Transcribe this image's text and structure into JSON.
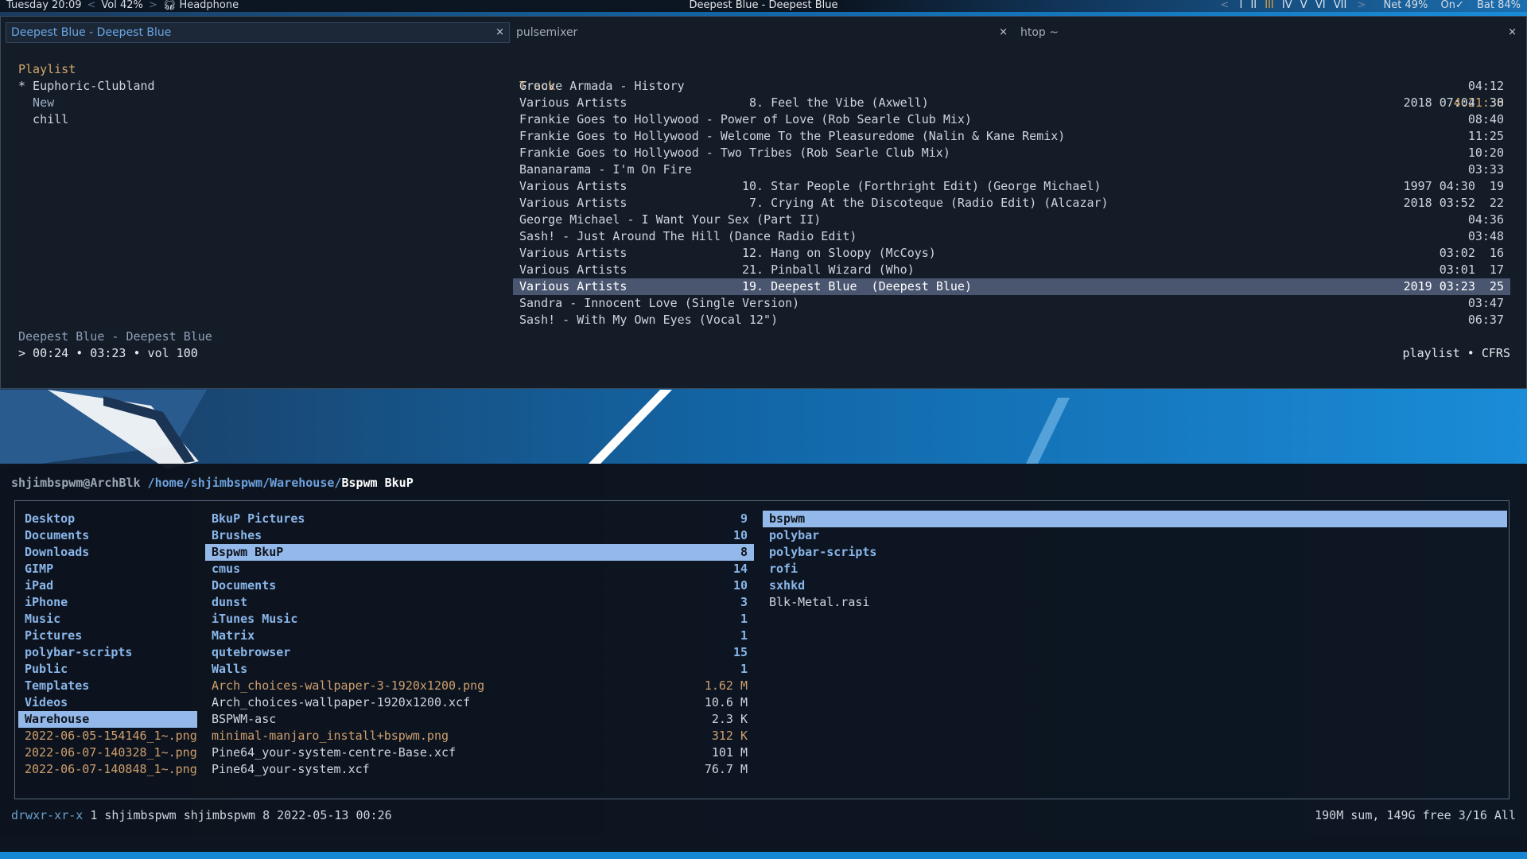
{
  "topbar": {
    "day_time": "Tuesday 20:09",
    "volume": "Vol 42%",
    "audio_device": "Headphone",
    "window_title": "Deepest Blue - Deepest Blue",
    "workspaces": [
      "I",
      "II",
      "III",
      "IV",
      "V",
      "VI",
      "VII"
    ],
    "active_workspace": "III",
    "net": "Net 49%",
    "on_status": "On✓",
    "battery": "Bat 84%"
  },
  "tabs": [
    {
      "label": "Deepest Blue - Deepest Blue",
      "close": "×"
    },
    {
      "label": "pulsemixer",
      "close": "×"
    },
    {
      "label": "htop ~",
      "close": "×"
    }
  ],
  "playlist": {
    "header": "Playlist",
    "items": [
      "* Euphoric-Clubland",
      "  New",
      "  chill"
    ]
  },
  "tracks": {
    "header": "Track",
    "total_duration": "4:21:38",
    "rows": [
      {
        "artist": "Groove Armada - History",
        "title": "",
        "right": "04:12"
      },
      {
        "artist": "Various Artists",
        "title": " 8. Feel the Vibe (Axwell)",
        "right": "2018 07:04  30"
      },
      {
        "artist": "Frankie Goes to Hollywood - Power of Love (Rob Searle Club Mix)",
        "title": "",
        "right": "08:40"
      },
      {
        "artist": "Frankie Goes to Hollywood - Welcome To the Pleasuredome (Nalin & Kane Remix)",
        "title": "",
        "right": "11:25"
      },
      {
        "artist": "Frankie Goes to Hollywood - Two Tribes (Rob Searle Club Mix)",
        "title": "",
        "right": "10:20"
      },
      {
        "artist": "Bananarama - I'm On Fire",
        "title": "",
        "right": "03:33"
      },
      {
        "artist": "Various Artists",
        "title": "10. Star People (Forthright Edit) (George Michael)",
        "right": "1997 04:30  19"
      },
      {
        "artist": "Various Artists",
        "title": " 7. Crying At the Discoteque (Radio Edit) (Alcazar)",
        "right": "2018 03:52  22"
      },
      {
        "artist": "George Michael - I Want Your Sex (Part II)",
        "title": "",
        "right": "04:36"
      },
      {
        "artist": "Sash! - Just Around The Hill (Dance Radio Edit)",
        "title": "",
        "right": "03:48"
      },
      {
        "artist": "Various Artists",
        "title": "12. Hang on Sloopy (McCoys)",
        "right": "03:02  16"
      },
      {
        "artist": "Various Artists",
        "title": "21. Pinball Wizard (Who)",
        "right": "03:01  17"
      },
      {
        "artist": "Various Artists",
        "title": "19. Deepest Blue  (Deepest Blue)",
        "right": "2019 03:23  25"
      },
      {
        "artist": "Sandra - Innocent Love (Single Version)",
        "title": "",
        "right": "03:47"
      },
      {
        "artist": "Sash! - With My Own Eyes (Vocal 12\")",
        "title": "",
        "right": "06:37"
      }
    ]
  },
  "player": {
    "now_playing": "Deepest Blue - Deepest Blue",
    "status": "> 00:24 • 03:23 • vol 100",
    "mode": "playlist • CFRS"
  },
  "ranger": {
    "user_host": "shjimbspwm@ArchBlk",
    "path_dir": "/home/shjimbspwm/Warehouse/",
    "path_current": "Bspwm BkuP",
    "col1": [
      {
        "name": "Desktop",
        "kind": "dir"
      },
      {
        "name": "Documents",
        "kind": "dir"
      },
      {
        "name": "Downloads",
        "kind": "dir"
      },
      {
        "name": "GIMP",
        "kind": "dir"
      },
      {
        "name": "iPad",
        "kind": "dir"
      },
      {
        "name": "iPhone",
        "kind": "dir"
      },
      {
        "name": "Music",
        "kind": "dir"
      },
      {
        "name": "Pictures",
        "kind": "dir"
      },
      {
        "name": "polybar-scripts",
        "kind": "dir"
      },
      {
        "name": "Public",
        "kind": "dir"
      },
      {
        "name": "Templates",
        "kind": "dir"
      },
      {
        "name": "Videos",
        "kind": "dir"
      },
      {
        "name": "Warehouse",
        "kind": "dir",
        "selected": true
      },
      {
        "name": "2022-06-05-154146_1~.png",
        "kind": "img"
      },
      {
        "name": "2022-06-07-140328_1~.png",
        "kind": "img"
      },
      {
        "name": "2022-06-07-140848_1~.png",
        "kind": "img"
      }
    ],
    "col2": [
      {
        "name": "BkuP Pictures",
        "size": "9",
        "kind": "dir"
      },
      {
        "name": "Brushes",
        "size": "10",
        "kind": "dir"
      },
      {
        "name": "Bspwm BkuP",
        "size": "8",
        "kind": "dir",
        "selected": true
      },
      {
        "name": "cmus",
        "size": "14",
        "kind": "dir"
      },
      {
        "name": "Documents",
        "size": "10",
        "kind": "dir"
      },
      {
        "name": "dunst",
        "size": "3",
        "kind": "dir"
      },
      {
        "name": "iTunes Music",
        "size": "1",
        "kind": "dir"
      },
      {
        "name": "Matrix",
        "size": "1",
        "kind": "dir"
      },
      {
        "name": "qutebrowser",
        "size": "15",
        "kind": "dir"
      },
      {
        "name": "Walls",
        "size": "1",
        "kind": "dir"
      },
      {
        "name": "Arch_choices-wallpaper-3-1920x1200.png",
        "size": "1.62 M",
        "kind": "img"
      },
      {
        "name": "Arch_choices-wallpaper-1920x1200.xcf",
        "size": "10.6 M",
        "kind": "file"
      },
      {
        "name": "BSPWM-asc",
        "size": "2.3 K",
        "kind": "file"
      },
      {
        "name": "minimal-manjaro_install+bspwm.png",
        "size": "312 K",
        "kind": "img"
      },
      {
        "name": "Pine64_your-system-centre-Base.xcf",
        "size": "101 M",
        "kind": "file"
      },
      {
        "name": "Pine64_your-system.xcf",
        "size": "76.7 M",
        "kind": "file"
      }
    ],
    "col3": [
      {
        "name": "bspwm",
        "kind": "dir",
        "selected": true
      },
      {
        "name": "polybar",
        "kind": "dir"
      },
      {
        "name": "polybar-scripts",
        "kind": "dir"
      },
      {
        "name": "rofi",
        "kind": "dir"
      },
      {
        "name": "sxhkd",
        "kind": "dir"
      },
      {
        "name": "Blk-Metal.rasi",
        "kind": "file"
      }
    ],
    "info_perm": "drwxr-xr-x",
    "info_rest": " 1 shjimbspwm shjimbspwm 8 2022-05-13 00:26",
    "info_right": "190M sum, 149G free  3/16  All"
  },
  "colors": {
    "accent_blue": "#1687d2",
    "selection": "#93b8ea",
    "playlist_header": "#d7a86a",
    "image_file": "#cf9f6d"
  }
}
